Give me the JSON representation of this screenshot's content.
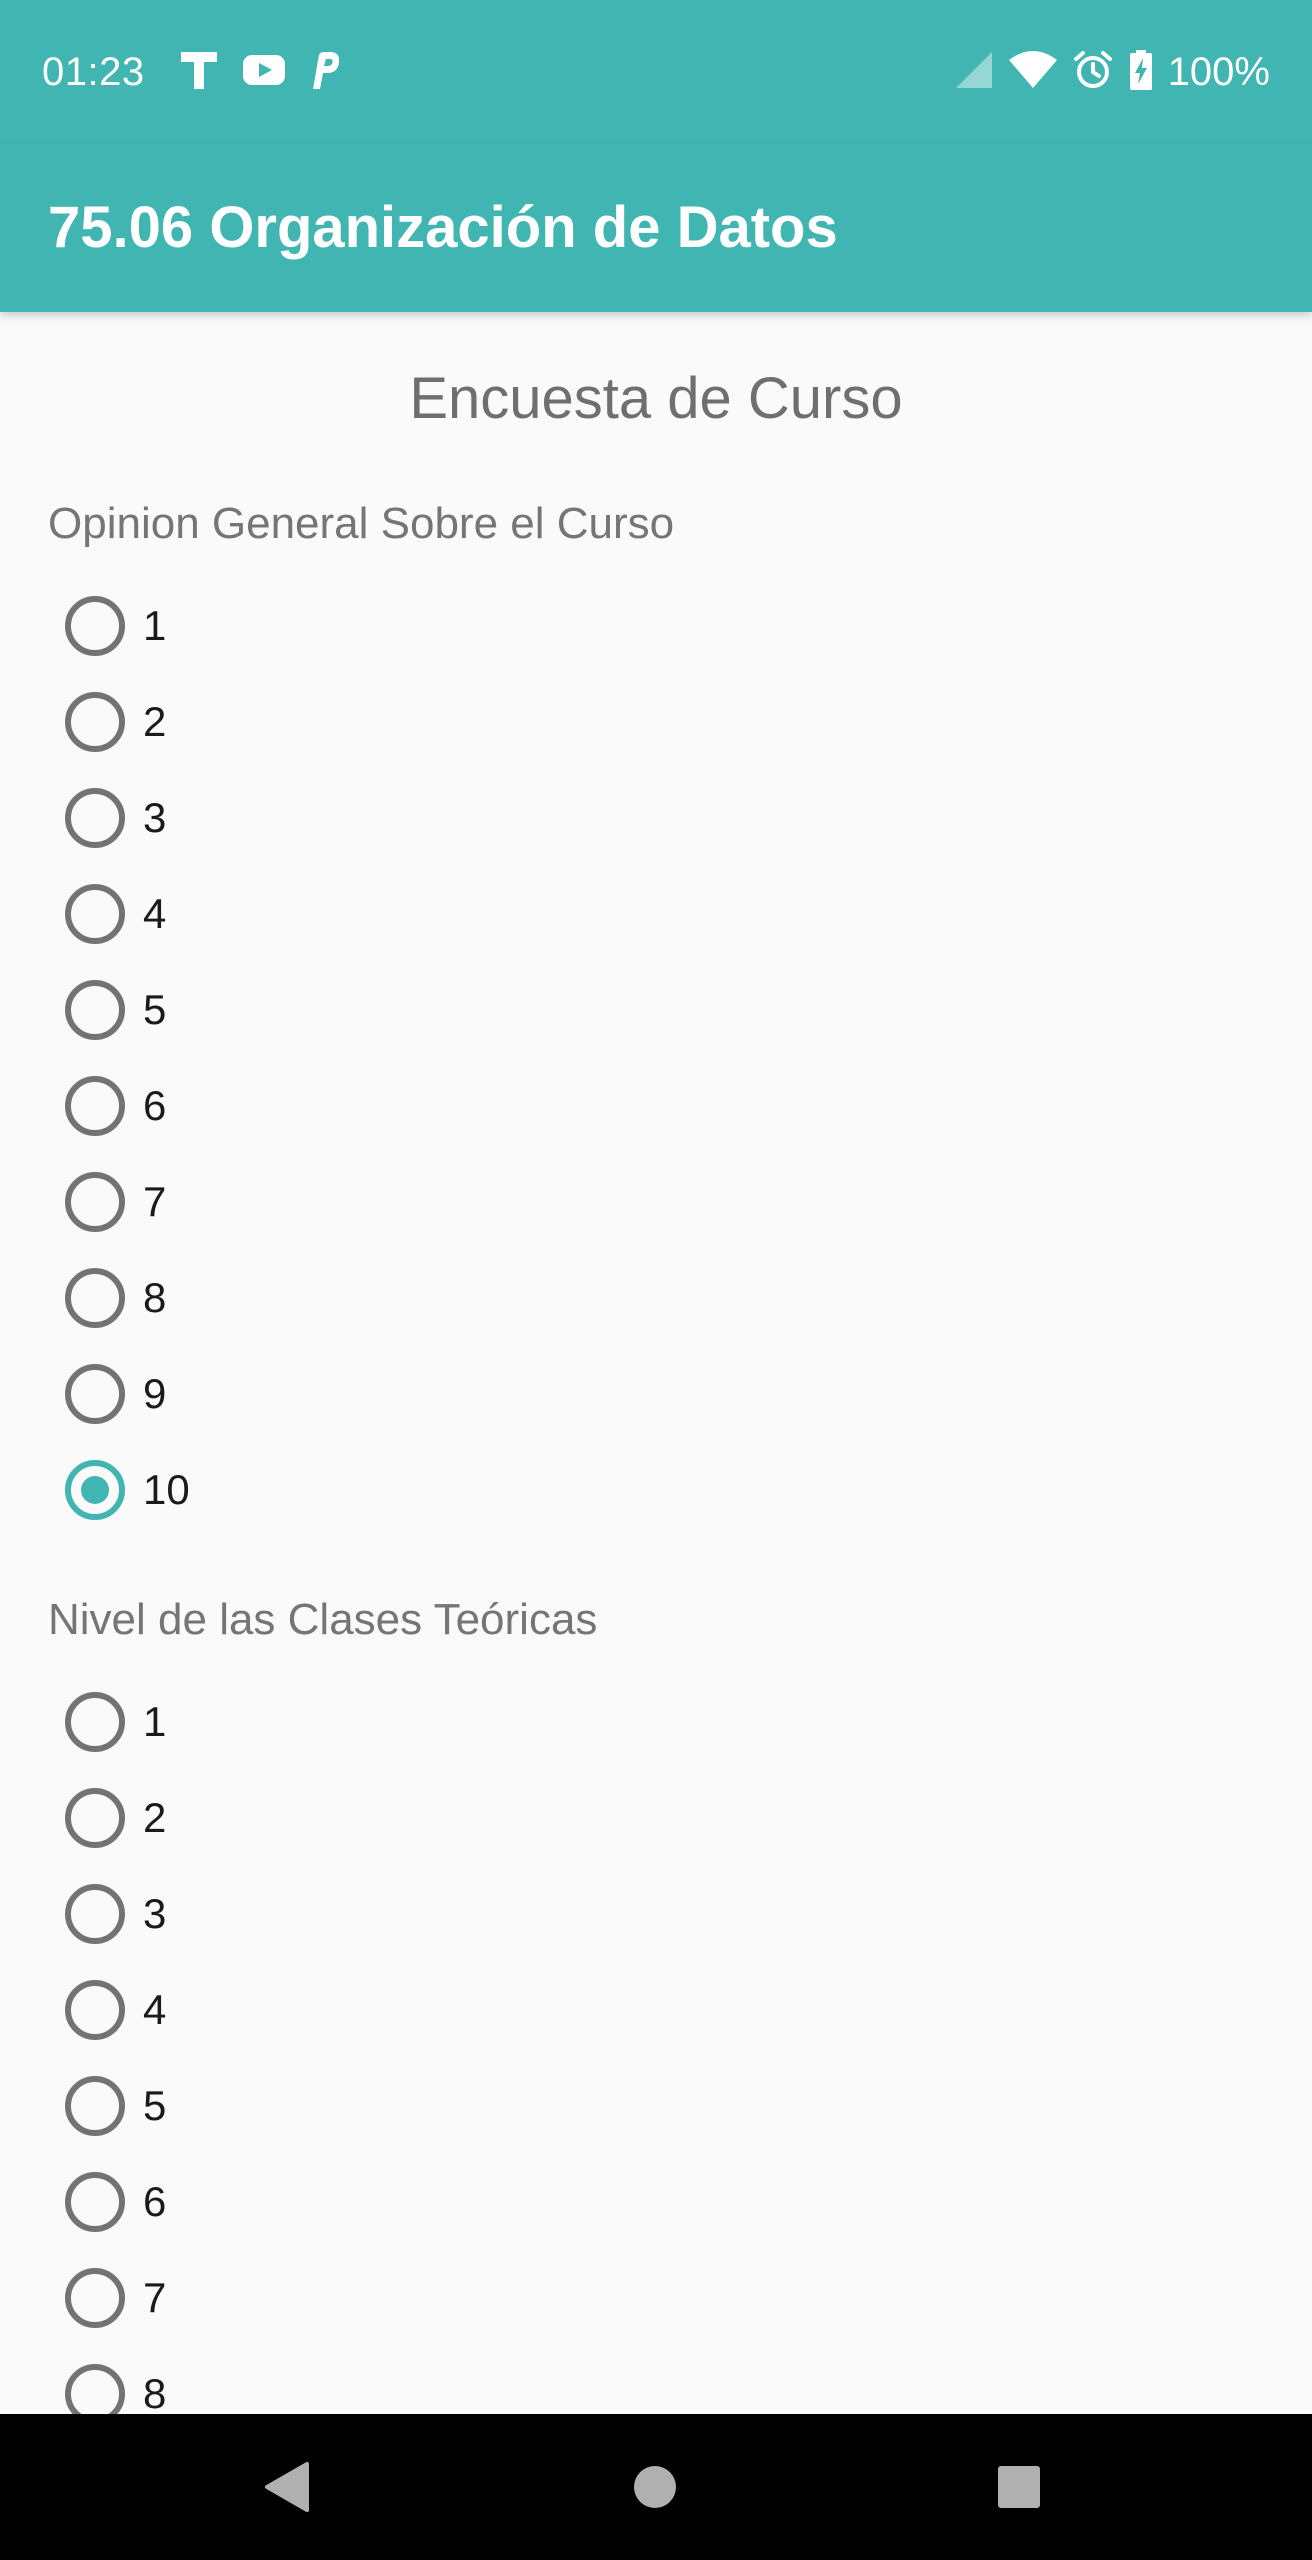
{
  "status_bar": {
    "time": "01:23",
    "battery": "100%",
    "notification_icons": [
      "t-icon",
      "youtube-icon",
      "p-icon"
    ],
    "system_icons": [
      "signal-icon",
      "wifi-icon",
      "alarm-icon",
      "battery-charging-icon"
    ]
  },
  "app_bar": {
    "title": "75.06 Organización de Datos"
  },
  "survey": {
    "title": "Encuesta de Curso",
    "questions": [
      {
        "label": "Opinion General Sobre el Curso",
        "options": [
          "1",
          "2",
          "3",
          "4",
          "5",
          "6",
          "7",
          "8",
          "9",
          "10"
        ],
        "selected": "10"
      },
      {
        "label": "Nivel de las Clases Teóricas",
        "options": [
          "1",
          "2",
          "3",
          "4",
          "5",
          "6",
          "7",
          "8"
        ],
        "selected": null
      }
    ]
  },
  "nav_bar": {
    "buttons": [
      "back-icon",
      "home-icon",
      "recents-icon"
    ]
  },
  "colors": {
    "accent": "#40b5b1",
    "background": "#fafafa",
    "radio_unchecked": "#737373"
  }
}
